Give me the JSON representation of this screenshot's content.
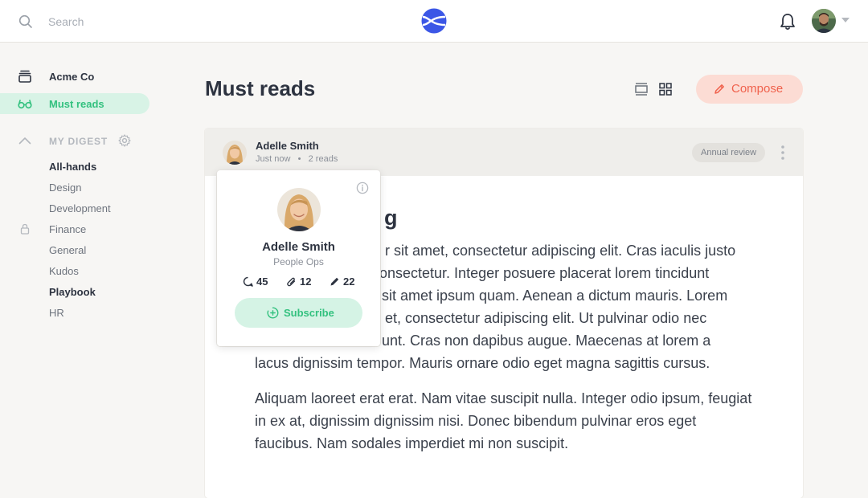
{
  "colors": {
    "accent_green": "#33c17f",
    "accent_green_bg": "#d8f3e6",
    "compose_red": "#f0624d",
    "compose_bg": "#fcdcd4",
    "logo_blue": "#3c57e6"
  },
  "topbar": {
    "search_placeholder": "Search",
    "icons": [
      "search-icon",
      "logo-icon",
      "bell-icon",
      "avatar",
      "chevron-down-icon"
    ]
  },
  "sidebar": {
    "items": [
      {
        "label": "Acme Co",
        "icon": "inbox-stack-icon",
        "active": false
      },
      {
        "label": "Must reads",
        "icon": "glasses-icon",
        "active": true
      }
    ],
    "digest": {
      "title": "MY DIGEST",
      "items": [
        {
          "label": "All-hands",
          "bold": true
        },
        {
          "label": "Design",
          "bold": false
        },
        {
          "label": "Development",
          "bold": false
        },
        {
          "label": "Finance",
          "bold": false,
          "locked": true
        },
        {
          "label": "General",
          "bold": false
        },
        {
          "label": "Kudos",
          "bold": false
        },
        {
          "label": "Playbook",
          "bold": true
        },
        {
          "label": "HR",
          "bold": false
        }
      ]
    }
  },
  "main": {
    "title": "Must reads",
    "compose_label": "Compose",
    "post": {
      "author": "Adelle Smith",
      "time": "Just now",
      "reads": "2 reads",
      "tag": "Annual review",
      "title_fragment": "g",
      "paragraph1_lines": [
        "r sit amet, consectetur adipiscing elit. Cras iaculis justo",
        "onsectetur. Integer posuere placerat lorem tincidunt",
        "sit amet ipsum quam. Aenean a dictum mauris. Lorem",
        "et, consectetur adipiscing elit. Ut pulvinar odio nec",
        "unt. Cras non dapibus augue. Maecenas at lorem a",
        "lacus dignissim tempor. Mauris ornare odio eget magna sagittis cursus."
      ],
      "paragraph2": "Aliquam laoreet erat erat. Nam vitae suscipit nulla. Integer odio ipsum, feugiat in ex at, dignissim dignissim nisi. Donec bibendum pulvinar eros eget faucibus. Nam sodales imperdiet mi non suscipit."
    }
  },
  "popover": {
    "name": "Adelle Smith",
    "role": "People Ops",
    "stats": {
      "comments": "45",
      "attachments": "12",
      "posts": "22"
    },
    "subscribe_label": "Subscribe"
  }
}
